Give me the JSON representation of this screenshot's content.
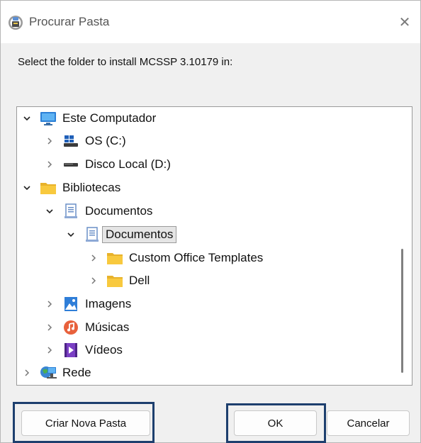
{
  "dialog": {
    "title": "Procurar Pasta",
    "close_glyph": "✕",
    "instruction": "Select the folder to install MCSSP 3.10179 in:"
  },
  "tree": [
    {
      "label": "Este Computador",
      "icon": "computer-icon",
      "expanded": true
    },
    {
      "label": "OS (C:)",
      "icon": "windows-drive-icon",
      "expanded": false
    },
    {
      "label": "Disco Local (D:)",
      "icon": "drive-icon",
      "expanded": false
    },
    {
      "label": "Bibliotecas",
      "icon": "folder-icon",
      "expanded": true
    },
    {
      "label": "Documentos",
      "icon": "documents-library-icon",
      "expanded": true
    },
    {
      "label": "Documentos",
      "icon": "documents-library-icon",
      "expanded": true,
      "selected": true
    },
    {
      "label": "Custom Office Templates",
      "icon": "folder-icon",
      "expanded": false
    },
    {
      "label": "Dell",
      "icon": "folder-icon",
      "expanded": false
    },
    {
      "label": "Imagens",
      "icon": "pictures-icon",
      "expanded": false
    },
    {
      "label": "Músicas",
      "icon": "music-icon",
      "expanded": false
    },
    {
      "label": "Vídeos",
      "icon": "videos-icon",
      "expanded": false
    },
    {
      "label": "Rede",
      "icon": "network-icon",
      "expanded": false
    }
  ],
  "buttons": {
    "new_folder": "Criar Nova Pasta",
    "ok": "OK",
    "cancel": "Cancelar"
  },
  "colors": {
    "highlight_border": "#1d3f6e",
    "folder_yellow": "#f8c93e",
    "computer_blue": "#2b7fd6"
  }
}
